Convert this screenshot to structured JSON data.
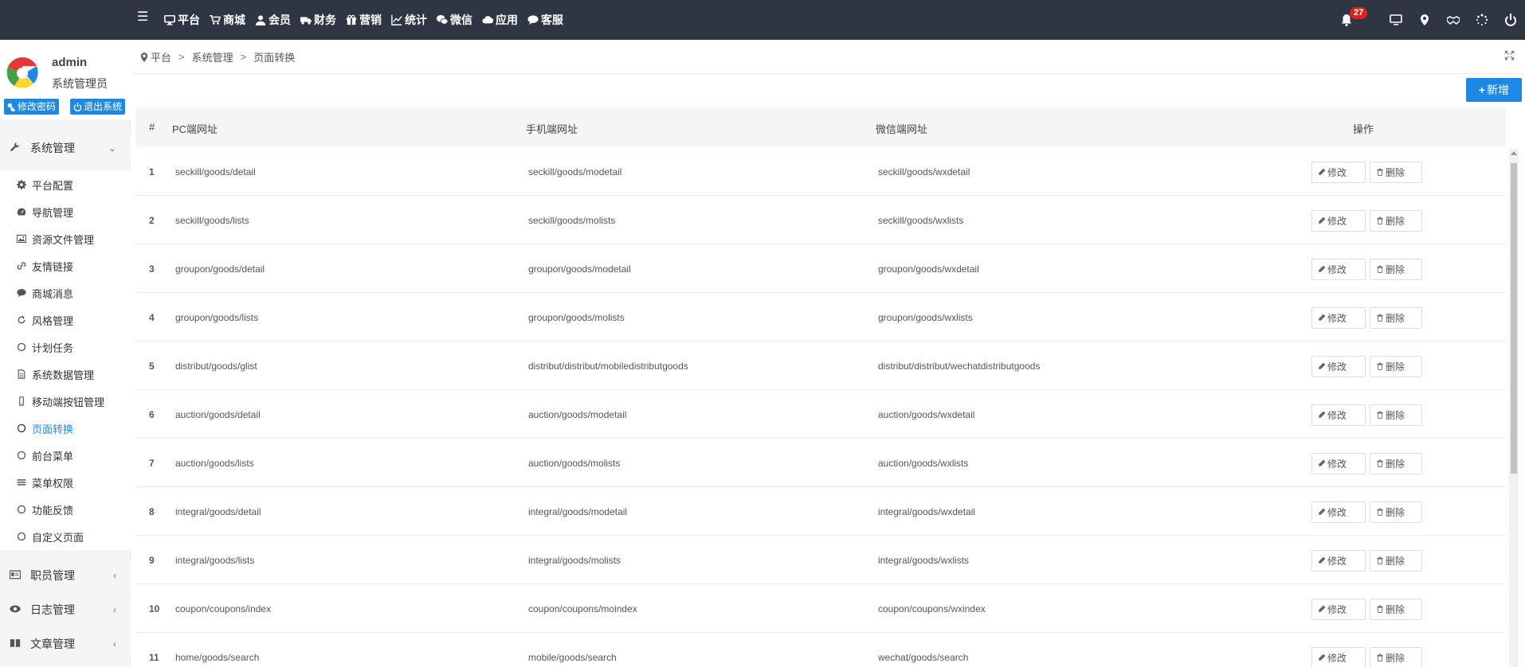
{
  "topnav": [
    {
      "label": "平台",
      "icon": "monitor-icon"
    },
    {
      "label": "商城",
      "icon": "cart-icon"
    },
    {
      "label": "会员",
      "icon": "user-icon"
    },
    {
      "label": "财务",
      "icon": "truck-icon"
    },
    {
      "label": "营销",
      "icon": "gift-icon"
    },
    {
      "label": "统计",
      "icon": "line-chart-icon"
    },
    {
      "label": "微信",
      "icon": "wechat-icon"
    },
    {
      "label": "应用",
      "icon": "cloud-icon"
    },
    {
      "label": "客服",
      "icon": "chat-icon"
    }
  ],
  "notifications": {
    "count": "27"
  },
  "profile": {
    "name": "admin",
    "role": "系统管理员",
    "change_password": "修改密码",
    "logout": "退出系统"
  },
  "sidebar": {
    "group_system": "系统管理",
    "items": [
      {
        "label": "平台配置",
        "icon": "gear-icon"
      },
      {
        "label": "导航管理",
        "icon": "dashboard-icon"
      },
      {
        "label": "资源文件管理",
        "icon": "image-icon"
      },
      {
        "label": "友情链接",
        "icon": "link-icon"
      },
      {
        "label": "商城消息",
        "icon": "comment-icon"
      },
      {
        "label": "风格管理",
        "icon": "refresh-icon"
      },
      {
        "label": "计划任务",
        "icon": "circle-icon"
      },
      {
        "label": "系统数据管理",
        "icon": "file-icon"
      },
      {
        "label": "移动端按钮管理",
        "icon": "mobile-icon"
      },
      {
        "label": "页面转换",
        "icon": "circle-icon"
      },
      {
        "label": "前台菜单",
        "icon": "circle-icon"
      },
      {
        "label": "菜单权限",
        "icon": "list-icon"
      },
      {
        "label": "功能反馈",
        "icon": "circle-icon"
      },
      {
        "label": "自定义页面",
        "icon": "circle-icon"
      }
    ],
    "group_staff": "职员管理",
    "group_log": "日志管理",
    "group_article": "文章管理"
  },
  "breadcrumb": {
    "home": "平台",
    "level1": "系统管理",
    "current": "页面转换"
  },
  "toolbar": {
    "add_label": "新增"
  },
  "table": {
    "headers": {
      "num": "#",
      "pc": "PC端网址",
      "mobile": "手机端网址",
      "wechat": "微信端网址",
      "action": "操作"
    },
    "edit_label": "修改",
    "delete_label": "删除",
    "rows": [
      {
        "num": "1",
        "pc": "seckill/goods/detail",
        "mobile": "seckill/goods/modetail",
        "wechat": "seckill/goods/wxdetail"
      },
      {
        "num": "2",
        "pc": "seckill/goods/lists",
        "mobile": "seckill/goods/molists",
        "wechat": "seckill/goods/wxlists"
      },
      {
        "num": "3",
        "pc": "groupon/goods/detail",
        "mobile": "groupon/goods/modetail",
        "wechat": "groupon/goods/wxdetail"
      },
      {
        "num": "4",
        "pc": "groupon/goods/lists",
        "mobile": "groupon/goods/molists",
        "wechat": "groupon/goods/wxlists"
      },
      {
        "num": "5",
        "pc": "distribut/goods/glist",
        "mobile": "distribut/distribut/mobiledistributgoods",
        "wechat": "distribut/distribut/wechatdistributgoods"
      },
      {
        "num": "6",
        "pc": "auction/goods/detail",
        "mobile": "auction/goods/modetail",
        "wechat": "auction/goods/wxdetail"
      },
      {
        "num": "7",
        "pc": "auction/goods/lists",
        "mobile": "auction/goods/molists",
        "wechat": "auction/goods/wxlists"
      },
      {
        "num": "8",
        "pc": "integral/goods/detail",
        "mobile": "integral/goods/modetail",
        "wechat": "integral/goods/wxdetail"
      },
      {
        "num": "9",
        "pc": "integral/goods/lists",
        "mobile": "integral/goods/molists",
        "wechat": "integral/goods/wxlists"
      },
      {
        "num": "10",
        "pc": "coupon/coupons/index",
        "mobile": "coupon/coupons/moindex",
        "wechat": "coupon/coupons/wxindex"
      },
      {
        "num": "11",
        "pc": "home/goods/search",
        "mobile": "mobile/goods/search",
        "wechat": "wechat/goods/search"
      }
    ]
  }
}
